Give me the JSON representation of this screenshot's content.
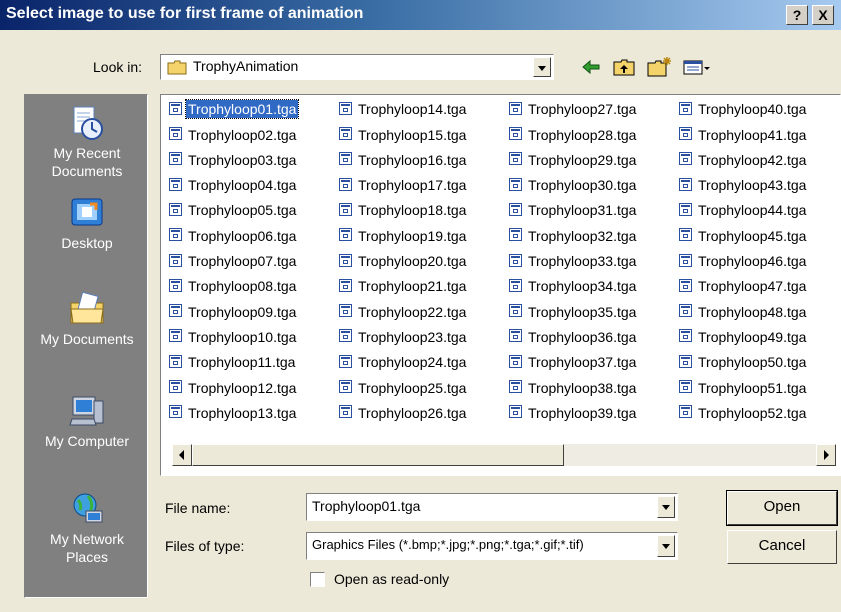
{
  "dialog": {
    "title": "Select image to use for first frame of animation",
    "help_label": "?",
    "close_label": "X"
  },
  "look_in": {
    "label": "Look in:",
    "value": "TrophyAnimation"
  },
  "toolbar": {
    "back_icon": "arrow-left-icon",
    "up_icon": "folder-up-icon",
    "new_folder_icon": "new-folder-icon",
    "view_menu_icon": "view-menu-icon"
  },
  "places": [
    {
      "label": "My Recent\nDocuments",
      "icon": "recent-documents-icon"
    },
    {
      "label": "Desktop",
      "icon": "desktop-icon"
    },
    {
      "label": "My Documents",
      "icon": "my-documents-icon"
    },
    {
      "label": "My Computer",
      "icon": "my-computer-icon"
    },
    {
      "label": "My Network\nPlaces",
      "icon": "network-places-icon"
    }
  ],
  "files": [
    "Trophyloop01.tga",
    "Trophyloop02.tga",
    "Trophyloop03.tga",
    "Trophyloop04.tga",
    "Trophyloop05.tga",
    "Trophyloop06.tga",
    "Trophyloop07.tga",
    "Trophyloop08.tga",
    "Trophyloop09.tga",
    "Trophyloop10.tga",
    "Trophyloop11.tga",
    "Trophyloop12.tga",
    "Trophyloop13.tga",
    "Trophyloop14.tga",
    "Trophyloop15.tga",
    "Trophyloop16.tga",
    "Trophyloop17.tga",
    "Trophyloop18.tga",
    "Trophyloop19.tga",
    "Trophyloop20.tga",
    "Trophyloop21.tga",
    "Trophyloop22.tga",
    "Trophyloop23.tga",
    "Trophyloop24.tga",
    "Trophyloop25.tga",
    "Trophyloop26.tga",
    "Trophyloop27.tga",
    "Trophyloop28.tga",
    "Trophyloop29.tga",
    "Trophyloop30.tga",
    "Trophyloop31.tga",
    "Trophyloop32.tga",
    "Trophyloop33.tga",
    "Trophyloop34.tga",
    "Trophyloop35.tga",
    "Trophyloop36.tga",
    "Trophyloop37.tga",
    "Trophyloop38.tga",
    "Trophyloop39.tga",
    "Trophyloop40.tga",
    "Trophyloop41.tga",
    "Trophyloop42.tga",
    "Trophyloop43.tga",
    "Trophyloop44.tga",
    "Trophyloop45.tga",
    "Trophyloop46.tga",
    "Trophyloop47.tga",
    "Trophyloop48.tga",
    "Trophyloop49.tga",
    "Trophyloop50.tga",
    "Trophyloop51.tga",
    "Trophyloop52.tga"
  ],
  "selected_file": "Trophyloop01.tga",
  "file_name": {
    "label": "File name:",
    "value": "Trophyloop01.tga"
  },
  "files_of_type": {
    "label": "Files of type:",
    "value": "Graphics Files (*.bmp;*.jpg;*.png;*.tga;*.gif;*.tif)"
  },
  "read_only": {
    "label": "Open as read-only",
    "checked": false
  },
  "buttons": {
    "open": "Open",
    "cancel": "Cancel"
  },
  "colors": {
    "selection": "#316ac5",
    "places_bar": "#808080",
    "dialog_bg": "#ece9d8"
  }
}
